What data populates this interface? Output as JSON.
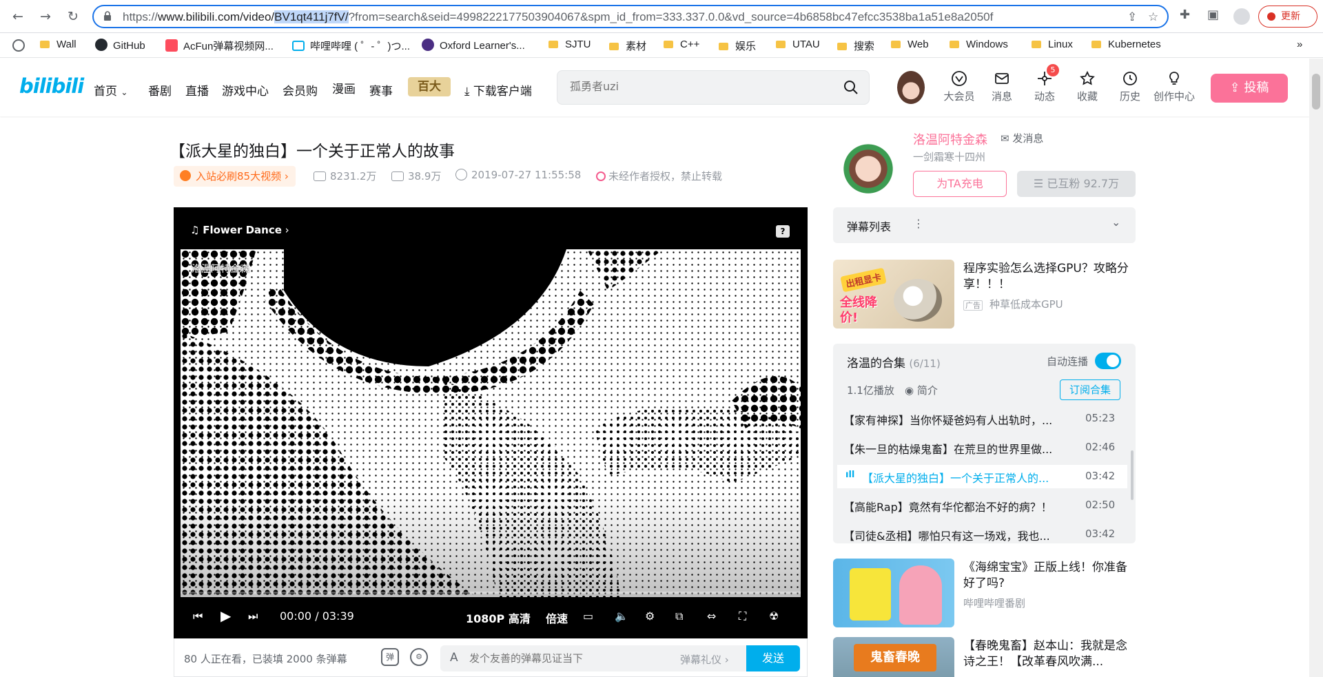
{
  "browser": {
    "url_prefix": "https://",
    "url_host": "www.bilibili.com",
    "url_path": "/video/",
    "url_selected": "BV1qt411j7fV/",
    "url_rest": "?from=search&seid=4998222177503904067&spm_id_from=333.337.0.0&vd_source=4b6858bc47efcc3538ba1a51e8a2050f",
    "update_label": "更新",
    "bookmarks": [
      "Wall",
      "GitHub",
      "AcFun弹幕视频网...",
      "哔哩哔哩 ( ゜- ゜)つ...",
      "Oxford Learner's...",
      "SJTU",
      "素材",
      "C++",
      "娱乐",
      "UTAU",
      "搜索",
      "Web",
      "Windows",
      "Linux",
      "Kubernetes"
    ]
  },
  "header": {
    "logo": "bilibili",
    "nav": [
      "首页",
      "番剧",
      "直播",
      "游戏中心",
      "会员购",
      "漫画",
      "赛事",
      "下载客户端"
    ],
    "event_logo": "百大",
    "search_placeholder": "孤勇者uzi",
    "icons": [
      {
        "name": "vip-icon",
        "label": "大会员"
      },
      {
        "name": "message-icon",
        "label": "消息"
      },
      {
        "name": "dynamic-icon",
        "label": "动态"
      },
      {
        "name": "favorite-icon",
        "label": "收藏"
      },
      {
        "name": "history-icon",
        "label": "历史"
      },
      {
        "name": "creator-icon",
        "label": "创作中心"
      }
    ],
    "dynamic_badge": "5",
    "upload_label": "投稿"
  },
  "video": {
    "title": "【派大星的独白】一个关于正常人的故事",
    "rank_badge": "入站必刷85大视频",
    "plays": "8231.2万",
    "danmaku_count": "38.9万",
    "pubdate": "2019-07-27 11:55:58",
    "copyright": "未经作者授权，禁止转载"
  },
  "player": {
    "song": "Flower Dance",
    "help_label": "?",
    "watermark": "洛温阿特金森",
    "current_time": "00:00",
    "separator": "/",
    "duration": "03:39",
    "quality": "1080P 高清",
    "speed": "倍速",
    "progress": 0
  },
  "danmaku_bar": {
    "viewers": "80 人正在看，已装填 2000 条弹幕",
    "input_placeholder": "发个友善的弹幕见证当下",
    "etiquette": "弹幕礼仪",
    "send": "发送"
  },
  "uploader": {
    "name": "洛温阿特金森",
    "message_link": "发消息",
    "description": "一剑霜寒十四州",
    "charge_label": "为TA充电",
    "follow_label": "已互粉 92.7万"
  },
  "danmaku_list": {
    "title": "弹幕列表"
  },
  "ad_card": {
    "title": "程序实验怎么选择GPU？攻略分享！！！",
    "ad_tag": "广告",
    "source": "种草低成本GPU",
    "thumb_text_1": "出租显卡",
    "thumb_text_2": "全线降价!"
  },
  "collection": {
    "title": "洛温的合集",
    "count": "(6/11)",
    "autoplay_label": "自动连播",
    "plays": "1.1亿播放",
    "intro_label": "简介",
    "subscribe_label": "订阅合集",
    "episodes": [
      {
        "title": "【家有神探】当你怀疑爸妈有人出轨时，...",
        "duration": "05:23"
      },
      {
        "title": "【朱一旦的枯燥鬼畜】在荒旦的世界里做...",
        "duration": "02:46"
      },
      {
        "title": "【派大星的独白】一个关于正常人的...",
        "duration": "03:42"
      },
      {
        "title": "【高能Rap】竟然有华佗都治不好的病？！",
        "duration": "02:50"
      },
      {
        "title": "【司徒&丞相】哪怕只有这一场戏，我也...",
        "duration": "03:42"
      }
    ]
  },
  "recommendations": [
    {
      "title": "《海绵宝宝》正版上线！你准备好了吗?",
      "source": "哔哩哔哩番剧"
    },
    {
      "title": "【春晚鬼畜】赵本山：我就是念诗之王！【改革春风吹满...",
      "thumb_text": "鬼畜春晚"
    }
  ],
  "colors": {
    "bili_blue": "#00aeec",
    "bili_pink": "#fb7299",
    "accent_orange": "#ff6a1a"
  }
}
